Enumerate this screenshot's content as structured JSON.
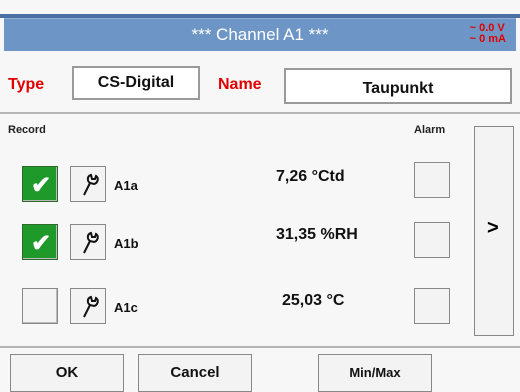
{
  "header": {
    "title": "***  Channel A1  ***",
    "voltage": "~ 0.0 V",
    "current": "~ 0 mA"
  },
  "config": {
    "type_label": "Type",
    "type_value": "CS-Digital",
    "name_label": "Name",
    "name_value": "Taupunkt"
  },
  "table": {
    "record_label": "Record",
    "alarm_label": "Alarm",
    "rows": [
      {
        "channel": "A1a",
        "value": "7,26 °Ctd",
        "recorded": true,
        "alarm": false
      },
      {
        "channel": "A1b",
        "value": "31,35 %RH",
        "recorded": true,
        "alarm": false
      },
      {
        "channel": "A1c",
        "value": "25,03 °C",
        "recorded": false,
        "alarm": false
      }
    ]
  },
  "nav": {
    "next_label": ">"
  },
  "footer": {
    "ok": "OK",
    "cancel": "Cancel",
    "minmax": "Min/Max"
  },
  "colors": {
    "title_bar": "#6d96c6",
    "accent_red": "#e00000",
    "checked_green": "#1f9a2a"
  }
}
